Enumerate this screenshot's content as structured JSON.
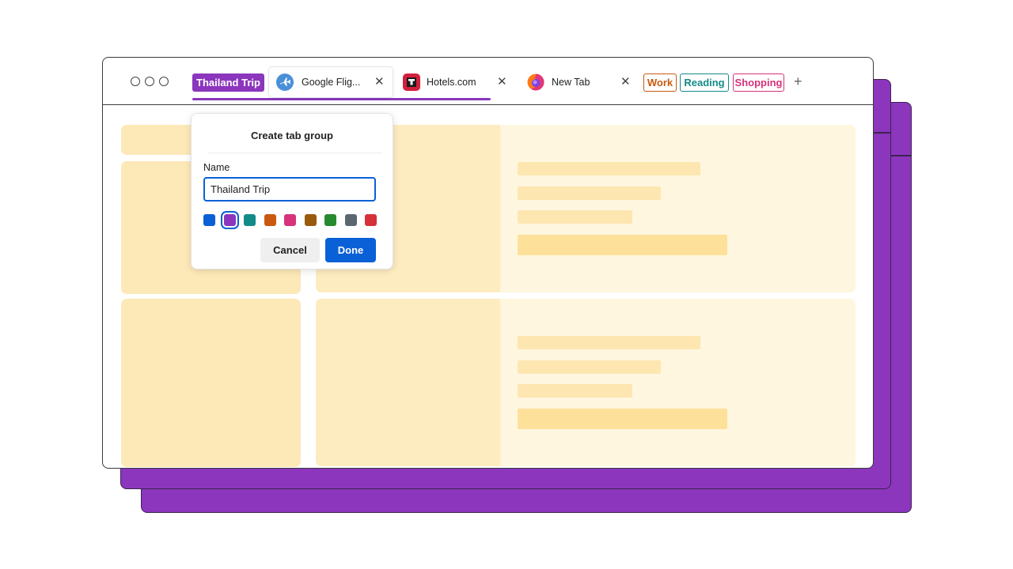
{
  "window": {
    "controls": [
      "close",
      "minimize",
      "maximize"
    ]
  },
  "tab_groups": {
    "active": {
      "label": "Thailand Trip",
      "color": "#8b36bd"
    },
    "collapsed": [
      {
        "label": "Work",
        "color": "#c8590f"
      },
      {
        "label": "Reading",
        "color": "#128b88"
      },
      {
        "label": "Shopping",
        "color": "#d6337b"
      }
    ]
  },
  "tabs": [
    {
      "title": "Google Flig...",
      "icon": "airplane-icon",
      "active": true
    },
    {
      "title": "Hotels.com",
      "icon": "hotels-icon",
      "active": false
    },
    {
      "title": "New Tab",
      "icon": "firefox-icon",
      "active": false
    }
  ],
  "dialog": {
    "title": "Create tab group",
    "name_label": "Name",
    "name_value": "Thailand Trip",
    "colors": [
      "#0a60d6",
      "#8b36bd",
      "#128b88",
      "#c8590f",
      "#d6337b",
      "#9a5a0d",
      "#278a2e",
      "#5b6670",
      "#d6303a"
    ],
    "selected_color_index": 1,
    "cancel_label": "Cancel",
    "done_label": "Done"
  },
  "colors": {
    "accent": "#0a60d6",
    "group_purple": "#8b36bd",
    "skeleton": "#fde9b7",
    "skeleton_light": "#fff6df"
  }
}
